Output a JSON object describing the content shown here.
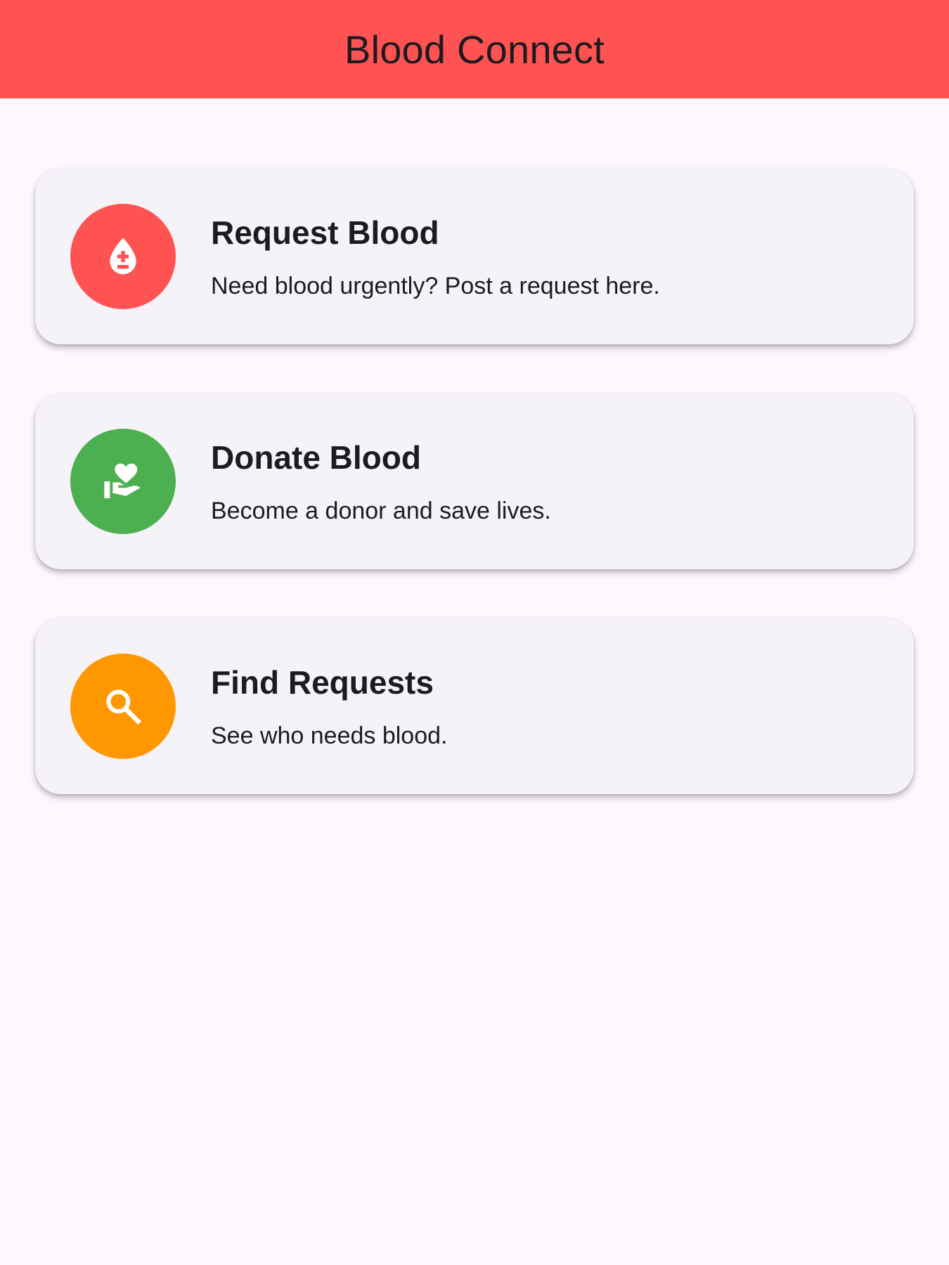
{
  "app_bar": {
    "title": "Blood Connect",
    "color": "#ff5252"
  },
  "cards": [
    {
      "title": "Request Blood",
      "subtitle": "Need blood urgently? Post a request here.",
      "icon": "blood-drop-plus-minus-icon",
      "avatar_color": "#ff5252"
    },
    {
      "title": "Donate Blood",
      "subtitle": "Become a donor and save lives.",
      "icon": "hand-heart-icon",
      "avatar_color": "#4caf50"
    },
    {
      "title": "Find Requests",
      "subtitle": "See who needs blood.",
      "icon": "search-icon",
      "avatar_color": "#ff9800"
    }
  ]
}
